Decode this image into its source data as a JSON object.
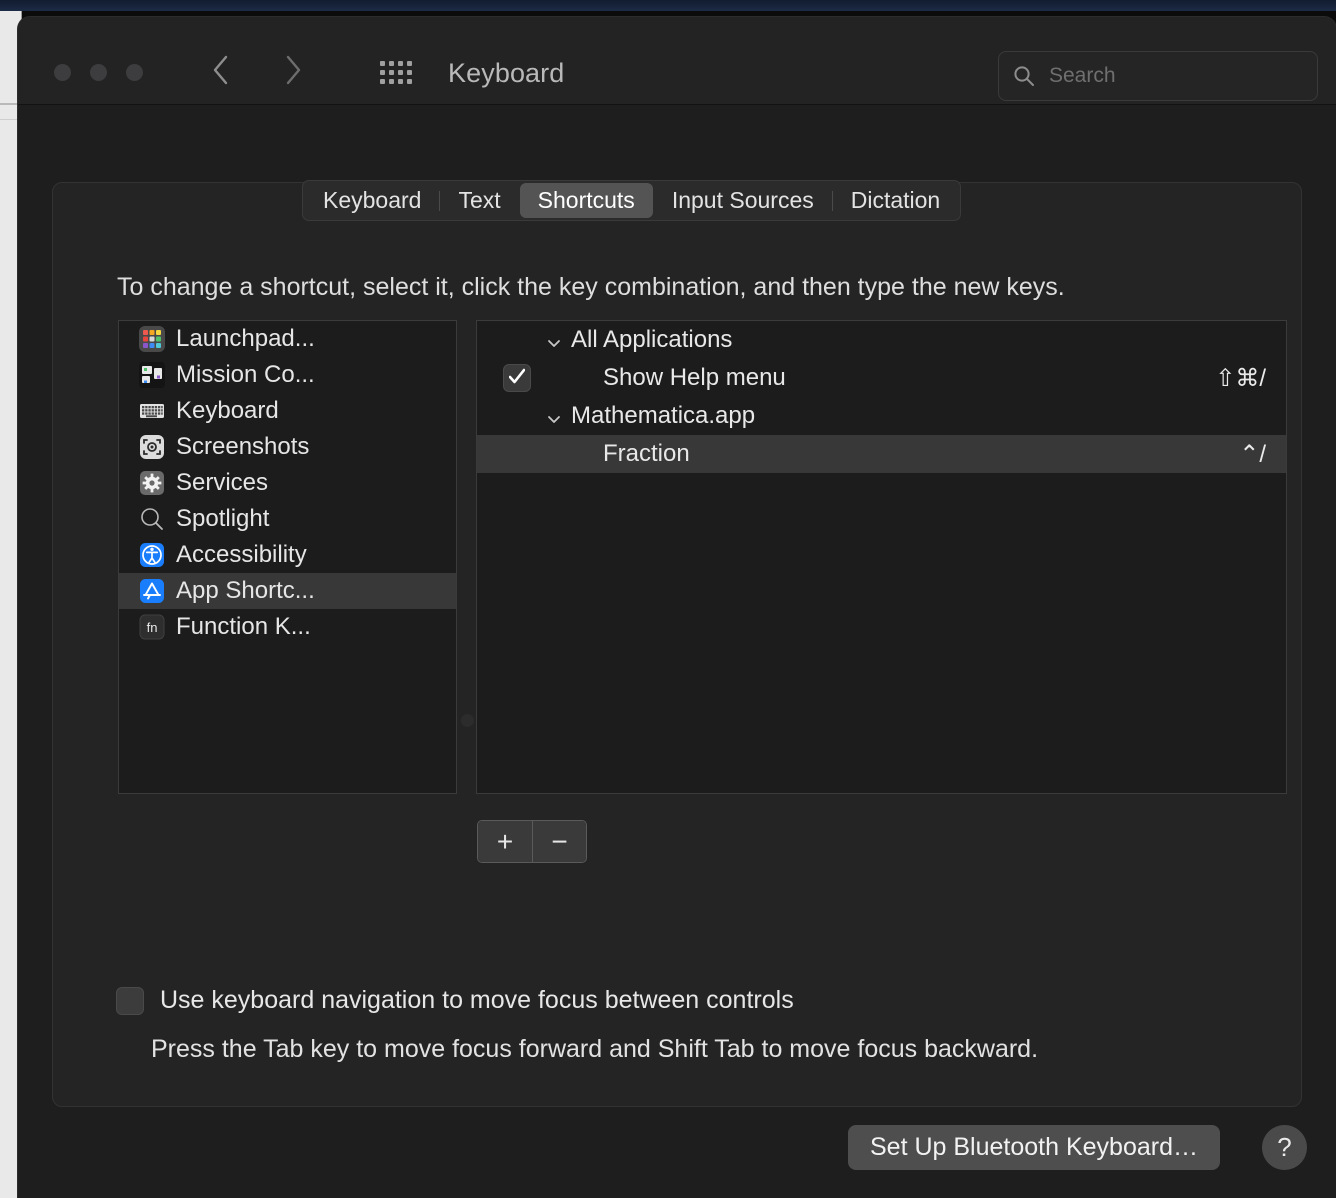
{
  "window": {
    "title": "Keyboard",
    "traffic_lights": [
      "close",
      "minimize",
      "zoom"
    ],
    "nav": {
      "back": "back-chevron",
      "forward": "forward-chevron",
      "grid": "show-all-grid"
    }
  },
  "search": {
    "placeholder": "Search",
    "value": "",
    "icon": "search-icon"
  },
  "tabs": [
    {
      "label": "Keyboard",
      "selected": false
    },
    {
      "label": "Text",
      "selected": false
    },
    {
      "label": "Shortcuts",
      "selected": true
    },
    {
      "label": "Input Sources",
      "selected": false
    },
    {
      "label": "Dictation",
      "selected": false
    }
  ],
  "instructions": "To change a shortcut, select it, click the key combination, and then type the new keys.",
  "categories": [
    {
      "label": "Launchpad...",
      "icon": "launchpad-icon",
      "selected": false
    },
    {
      "label": "Mission Co...",
      "icon": "mission-control-icon",
      "selected": false
    },
    {
      "label": "Keyboard",
      "icon": "keyboard-icon",
      "selected": false
    },
    {
      "label": "Screenshots",
      "icon": "screenshots-icon",
      "selected": false
    },
    {
      "label": "Services",
      "icon": "services-gear-icon",
      "selected": false
    },
    {
      "label": "Spotlight",
      "icon": "spotlight-icon",
      "selected": false
    },
    {
      "label": "Accessibility",
      "icon": "accessibility-icon",
      "selected": false
    },
    {
      "label": "App Shortc...",
      "icon": "app-shortcuts-icon",
      "selected": true
    },
    {
      "label": "Function K...",
      "icon": "function-keys-icon",
      "selected": false
    }
  ],
  "shortcut_tree": [
    {
      "label": "All Applications",
      "type": "group",
      "shortcut": "",
      "checked": null,
      "selected": false
    },
    {
      "label": "Show Help menu",
      "type": "child",
      "shortcut": "⇧⌘/",
      "checked": true,
      "selected": false
    },
    {
      "label": "Mathematica.app",
      "type": "group",
      "shortcut": "",
      "checked": null,
      "selected": false
    },
    {
      "label": "Fraction",
      "type": "child",
      "shortcut": "⌃/",
      "checked": null,
      "selected": true
    }
  ],
  "list_buttons": {
    "add": "+",
    "remove": "−"
  },
  "keyboard_navigation": {
    "checked": false,
    "label": "Use keyboard navigation to move focus between controls",
    "help": "Press the Tab key to move focus forward and Shift Tab to move focus backward."
  },
  "footer": {
    "bluetooth_button": "Set Up Bluetooth Keyboard…",
    "help_button": "?"
  },
  "colors": {
    "window_bg": "#1e1e1e",
    "toolbar_bg": "#232323",
    "card_bg": "#242424",
    "pane_bg": "#1c1c1c",
    "selection": "#383838",
    "accent_blue": "#1a7dfb",
    "text": "#e6e6e6"
  }
}
